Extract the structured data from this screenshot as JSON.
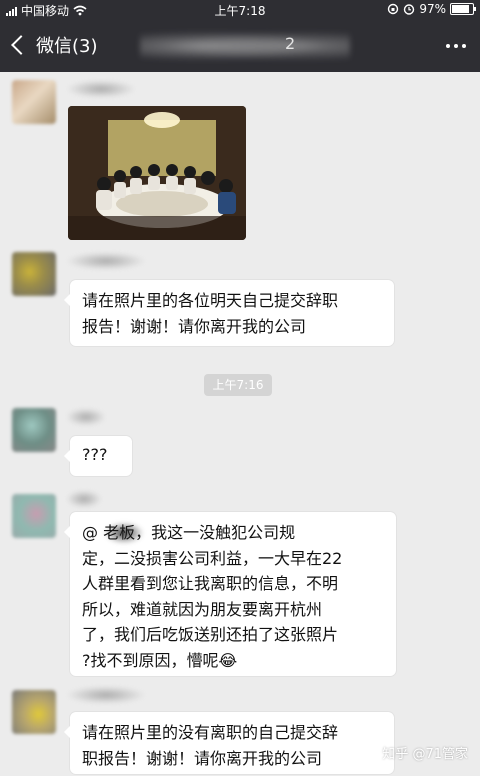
{
  "status_bar": {
    "carrier": "中国移动",
    "time": "上午7:18",
    "battery": "97%",
    "battery_level": 0.97
  },
  "nav": {
    "back_label": "微信(3)",
    "title_suffix": "2"
  },
  "messages": {
    "time_divider": "上午7:16",
    "m1_lines": [
      "请在照片里的各位明天自己提交辞职",
      "报告！谢谢！请你离开我的公司"
    ],
    "m2": "???",
    "m3_lines": [
      "@      老板，我这一没触犯公司规",
      "定，二没损害公司利益，一大早在22",
      "人群里看到您让我离职的信息，不明",
      "所以，难道就因为朋友要离开杭州",
      "了，我们后吃饭送别还拍了这张照片",
      "?找不到原因，懵呢😂"
    ],
    "m4_lines": [
      "请在照片里的没有离职的自己提交辞",
      "职报告！谢谢！请你离开我的公司"
    ]
  },
  "watermark": "知乎 @71管家",
  "colors": {
    "header_bg": "#2e2e33",
    "chat_bg": "#ececec",
    "bubble_bg": "#ffffff"
  },
  "icons": {
    "back": "chevron-left-icon",
    "more": "more-dots-icon",
    "wifi": "wifi-icon",
    "battery": "battery-icon"
  }
}
